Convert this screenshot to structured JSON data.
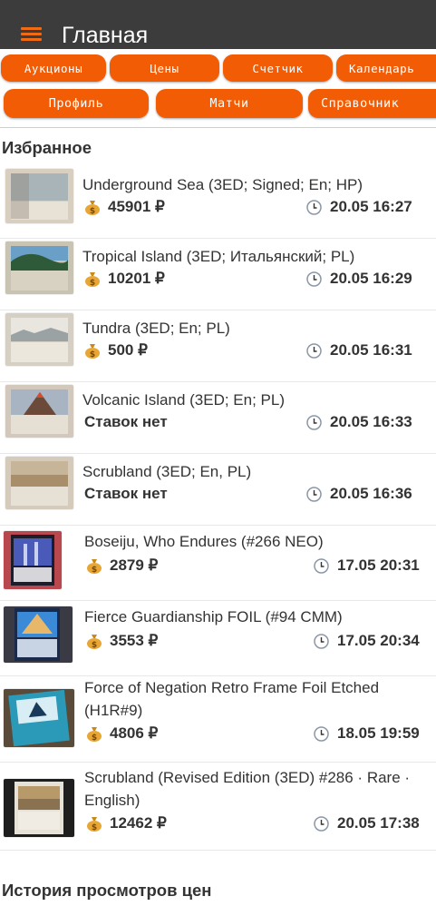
{
  "app": {
    "title": "Главная"
  },
  "nav_row1": [
    "Аукционы",
    "Цены",
    "Счетчик",
    "Календарь"
  ],
  "nav_row2": [
    "Профиль",
    "Матчи",
    "Справочник"
  ],
  "favorites": {
    "title": "Избранное",
    "items": [
      {
        "name": "Underground Sea (3ED; Signed; En; HP)",
        "price": "45901 ₽",
        "time": "20.05 16:27",
        "thumb": "sea"
      },
      {
        "name": "Tropical Island (3ED; Итальянский; PL)",
        "price": "10201 ₽",
        "time": "20.05 16:29",
        "thumb": "tropical"
      },
      {
        "name": "Tundra (3ED; En; PL)",
        "price": "500 ₽",
        "time": "20.05 16:31",
        "thumb": "tundra"
      },
      {
        "name": "Volcanic Island (3ED; En; PL)",
        "price": "Ставок нет",
        "time": "20.05 16:33",
        "thumb": "volcanic"
      },
      {
        "name": "Scrubland (3ED; En, PL)",
        "price": "Ставок нет",
        "time": "20.05 16:36",
        "thumb": "scrub"
      },
      {
        "name": "Boseiju, Who Endures (#266 NEO)",
        "price": "2879 ₽",
        "time": "17.05 20:31",
        "thumb": "boseiju"
      },
      {
        "name": "Fierce Guardianship FOIL (#94 CMM)",
        "price": "3553 ₽",
        "time": "17.05 20:34",
        "thumb": "fierce"
      },
      {
        "name": "Force of Negation Retro Frame Foil Etched (H1R#9)",
        "price": "4806 ₽",
        "time": "18.05 19:59",
        "thumb": "force"
      },
      {
        "name": "Scrubland (Revised Edition (3ED) #286 · Rare · English)",
        "price": "12462 ₽",
        "time": "20.05 17:38",
        "thumb": "scrub2"
      }
    ]
  },
  "history": {
    "title": "История просмотров цен"
  },
  "colors": {
    "accent": "#f25c05",
    "appbar": "#3c3c3c"
  },
  "icons": {
    "price": "money-bag-icon",
    "time": "clock-icon",
    "menu": "hamburger-icon"
  }
}
